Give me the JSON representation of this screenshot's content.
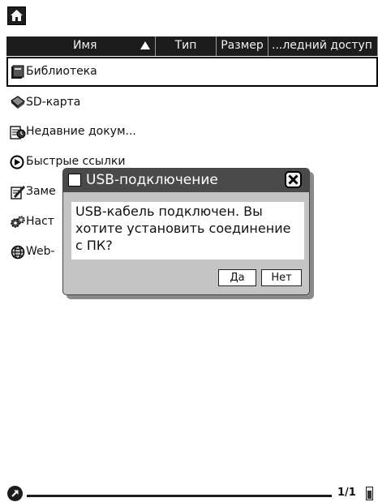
{
  "toolbar": {
    "home_icon": "home-icon"
  },
  "columns": [
    {
      "label": "Имя",
      "sort": "ascending"
    },
    {
      "label": "Тип"
    },
    {
      "label": "Размер"
    },
    {
      "label": "...ледний доступ"
    }
  ],
  "items": [
    {
      "label": "Библиотека",
      "icon": "book-icon"
    },
    {
      "label": "SD-карта",
      "icon": "sd-card-icon"
    },
    {
      "label": "Недавние докум...",
      "icon": "recent-documents-icon"
    },
    {
      "label": "Быстрые ссылки",
      "icon": "quick-links-icon"
    },
    {
      "label": "Заме",
      "icon": "notes-icon"
    },
    {
      "label": "Наст",
      "icon": "settings-icon"
    },
    {
      "label": "Web-",
      "icon": "web-icon"
    }
  ],
  "dialog": {
    "title": "USB-подключение",
    "message": "USB-кабель подключен. Вы хотите установить соединение с ПК?",
    "yes_label": "Да",
    "no_label": "Нет"
  },
  "status": {
    "page": "1/1",
    "battery_level": 0.7
  }
}
